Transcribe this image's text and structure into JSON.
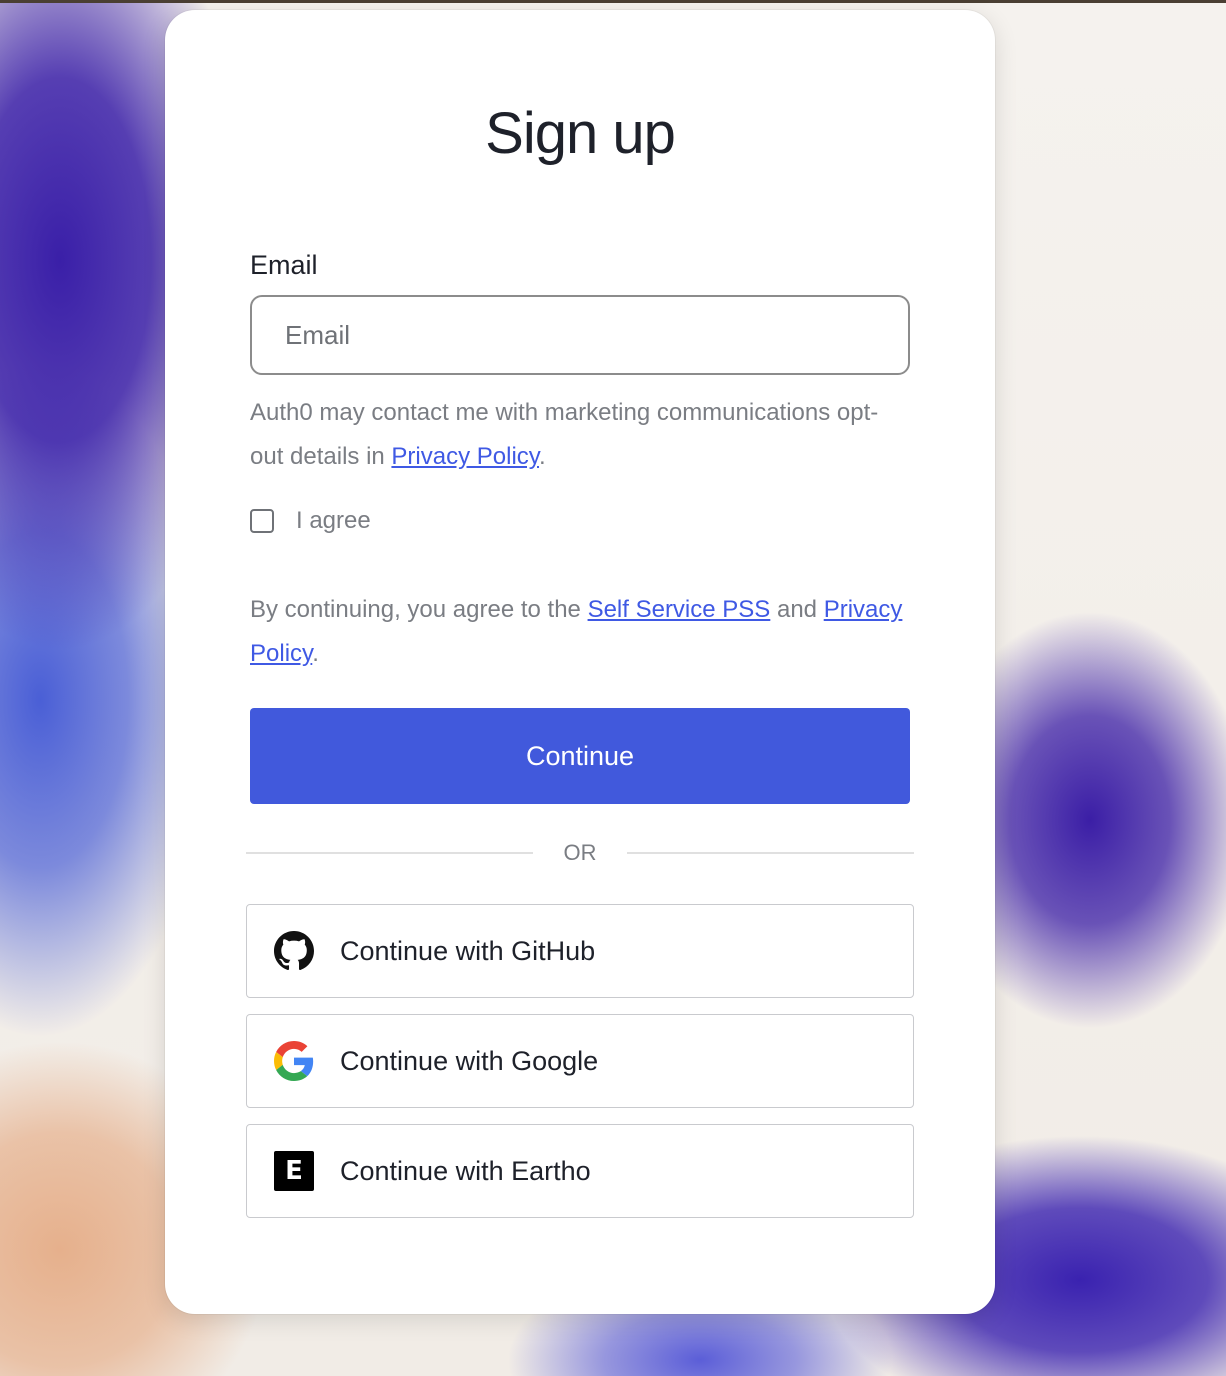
{
  "page": {
    "title": "Sign up"
  },
  "form": {
    "email_label": "Email",
    "email_placeholder": "Email",
    "email_value": "",
    "marketing_text": "Auth0 may contact me with marketing communications opt-out details in ",
    "marketing_link": "Privacy Policy",
    "marketing_end": ".",
    "agree_label": "I agree",
    "agree_checked": false,
    "terms_text_1": "By continuing, you agree to the ",
    "terms_link_1": "Self Service PSS",
    "terms_text_2": " and ",
    "terms_link_2": "Privacy Policy",
    "terms_end": ".",
    "continue_label": "Continue"
  },
  "divider": {
    "label": "OR"
  },
  "social": [
    {
      "label": "Continue with GitHub",
      "icon": "github-icon"
    },
    {
      "label": "Continue with Google",
      "icon": "google-icon"
    },
    {
      "label": "Continue with Eartho",
      "icon": "eartho-icon",
      "icon_letter": "E"
    }
  ],
  "colors": {
    "primary": "#4159dc",
    "link": "#3f59e4",
    "text": "#1e212a",
    "muted": "#7a7d83"
  }
}
